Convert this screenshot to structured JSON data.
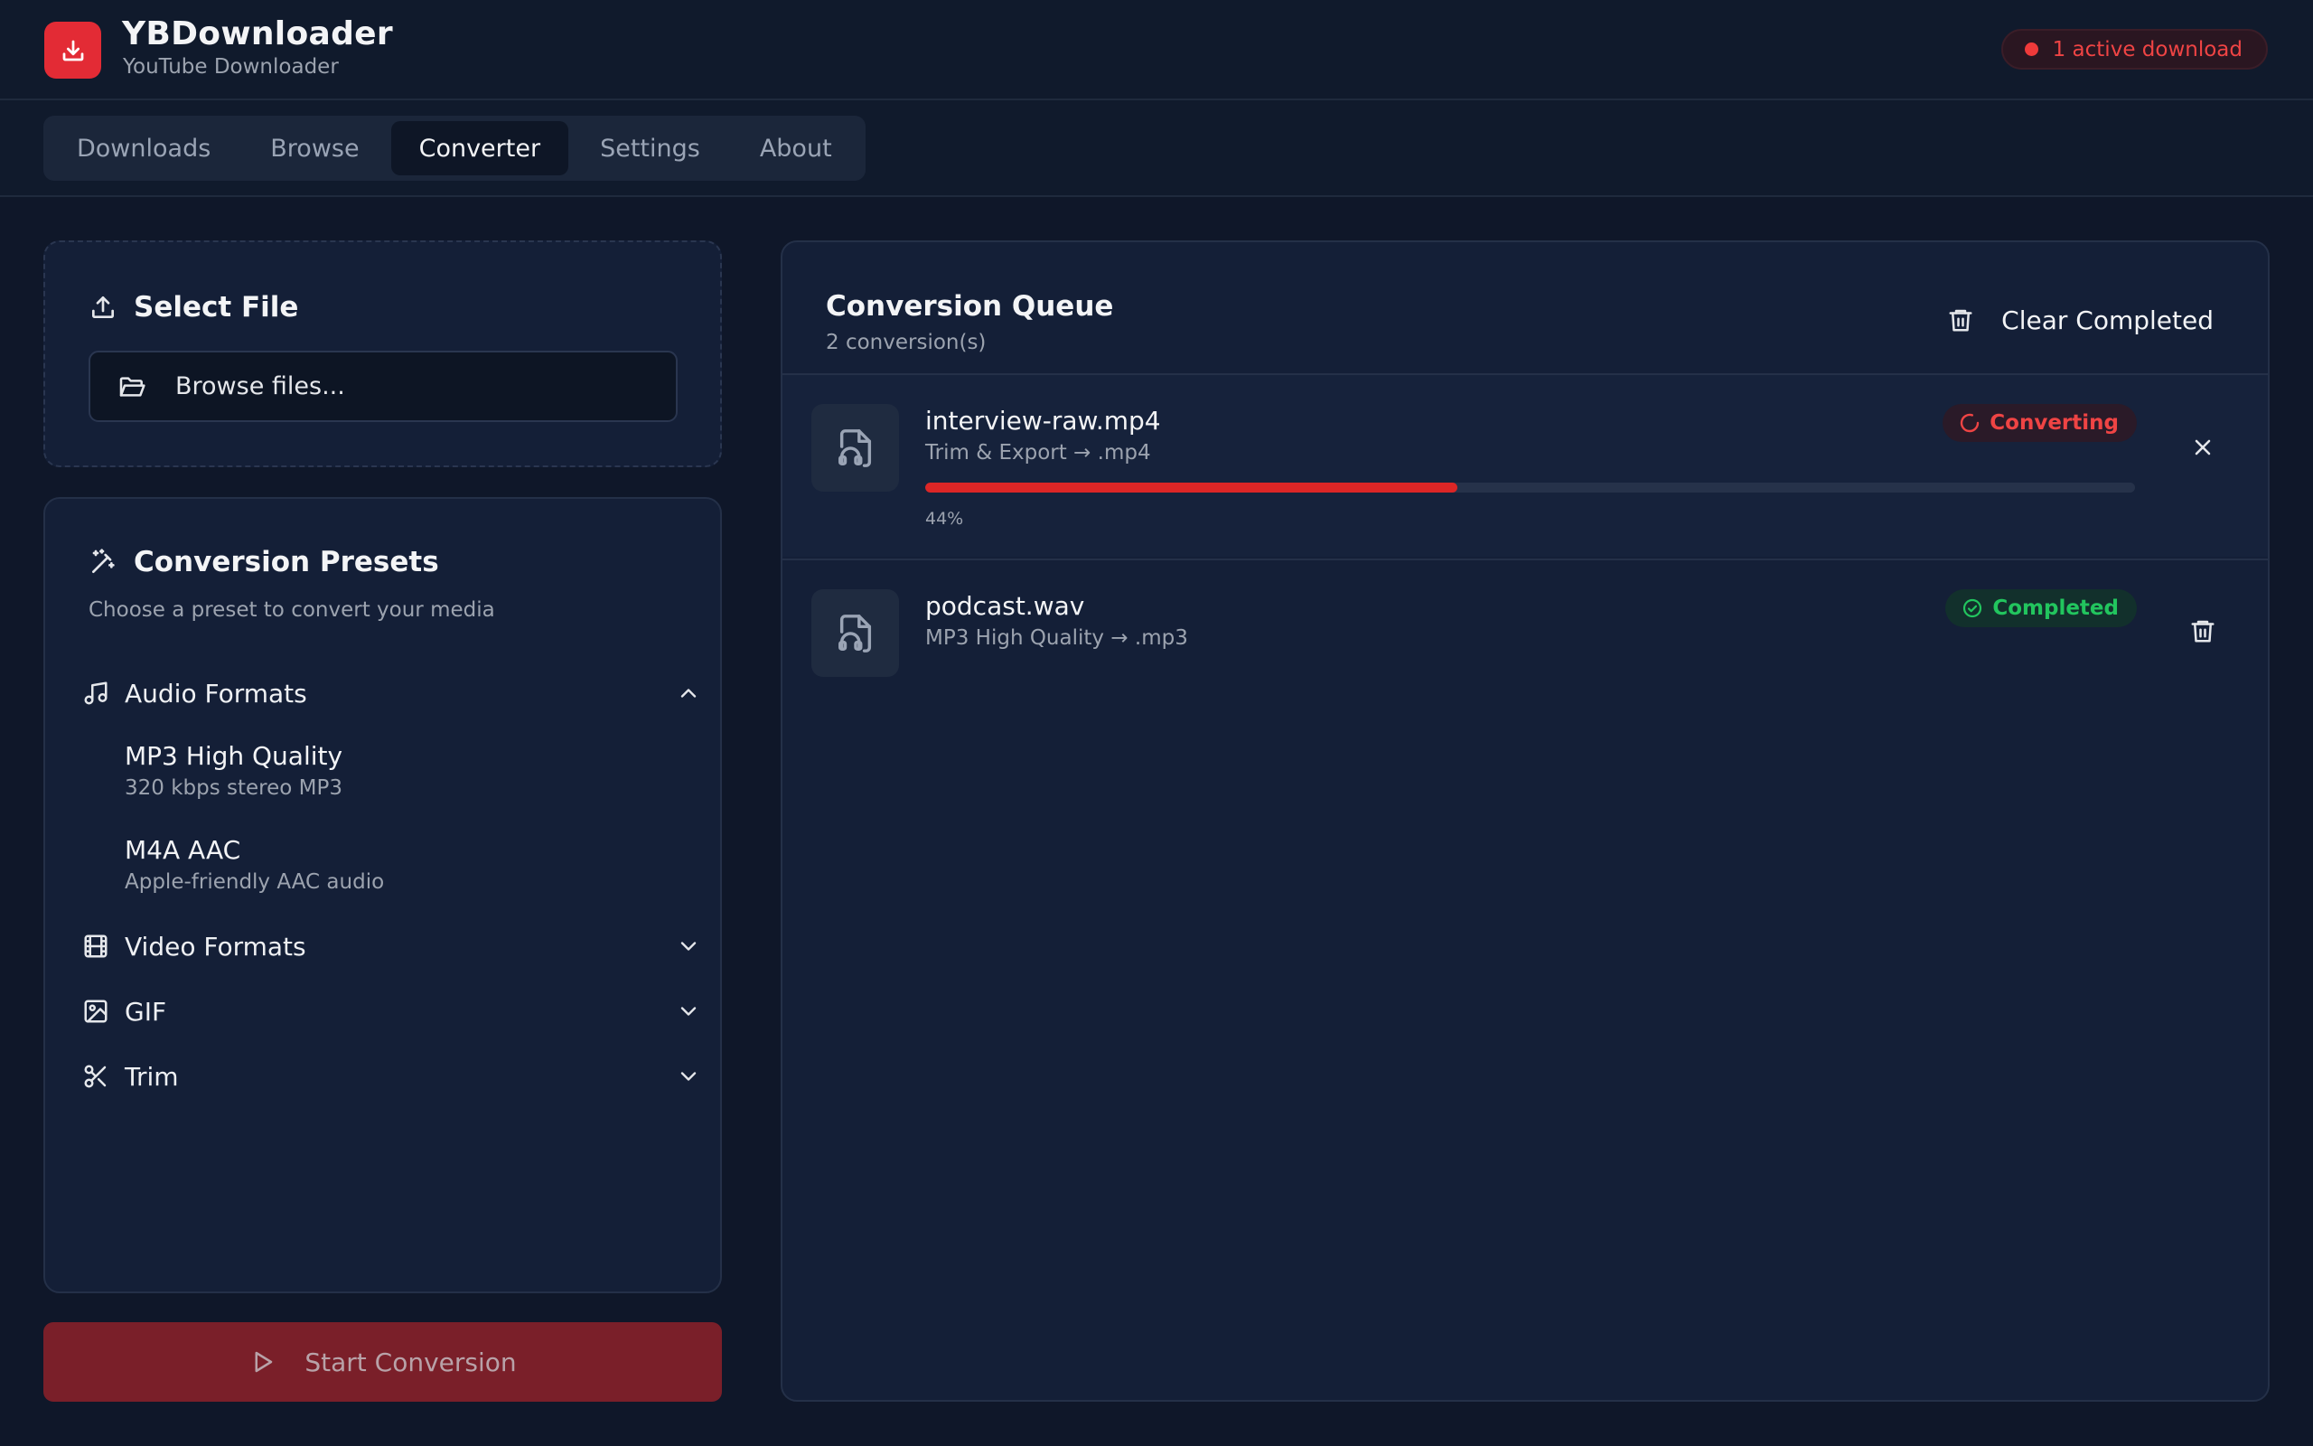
{
  "app": {
    "title": "YBDownloader",
    "subtitle": "YouTube Downloader",
    "active_downloads_label": "1 active download",
    "accent": "#e32b35"
  },
  "tabs": [
    {
      "label": "Downloads",
      "active": false
    },
    {
      "label": "Browse",
      "active": false
    },
    {
      "label": "Converter",
      "active": true
    },
    {
      "label": "Settings",
      "active": false
    },
    {
      "label": "About",
      "active": false
    }
  ],
  "select_file": {
    "title": "Select File",
    "browse_label": "Browse files..."
  },
  "presets": {
    "title": "Conversion Presets",
    "description": "Choose a preset to convert your media",
    "groups": [
      {
        "label": "Audio Formats",
        "icon": "music-note-icon",
        "expanded": true,
        "items": [
          {
            "name": "MP3 High Quality",
            "desc": "320 kbps stereo MP3"
          },
          {
            "name": "M4A AAC",
            "desc": "Apple-friendly AAC audio"
          }
        ]
      },
      {
        "label": "Video Formats",
        "icon": "film-icon",
        "expanded": false
      },
      {
        "label": "GIF",
        "icon": "image-icon",
        "expanded": false
      },
      {
        "label": "Trim",
        "icon": "scissors-icon",
        "expanded": false
      }
    ]
  },
  "start_button_label": "Start Conversion",
  "queue": {
    "title": "Conversion Queue",
    "count_label": "2 conversion(s)",
    "clear_label": "Clear Completed",
    "items": [
      {
        "file": "interview-raw.mp4",
        "meta": "Trim & Export → .mp4",
        "status": "Converting",
        "progress": 0.44,
        "progress_label": "44%"
      },
      {
        "file": "podcast.wav",
        "meta": "MP3 High Quality → .mp3",
        "status": "Completed"
      }
    ]
  }
}
